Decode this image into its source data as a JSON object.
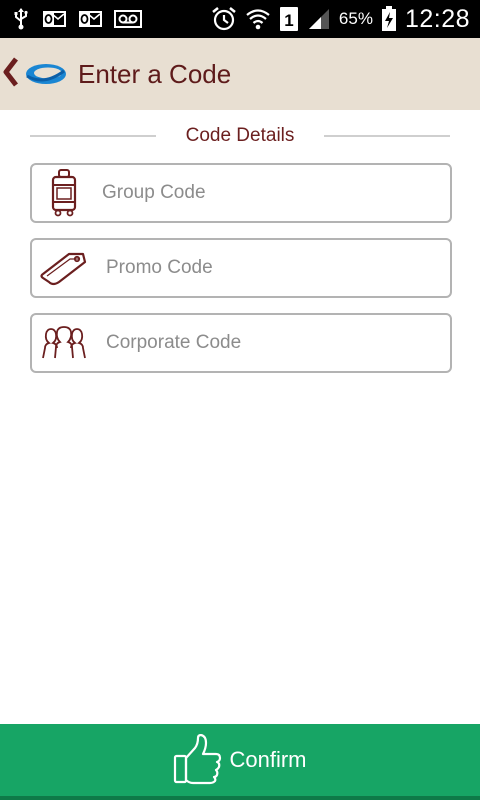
{
  "status_bar": {
    "battery_percent": "65%",
    "time": "12:28",
    "sim_slot": "1",
    "icons": [
      "usb-icon",
      "outlook-icon",
      "outlook-icon",
      "voicemail-icon",
      "alarm-icon",
      "wifi-icon",
      "sim-icon",
      "signal-icon",
      "battery-charging-icon"
    ]
  },
  "header": {
    "title": "Enter a Code",
    "back_icon": "chevron-left-icon",
    "logo_icon": "brand-logo-icon"
  },
  "section": {
    "title": "Code Details"
  },
  "fields": [
    {
      "placeholder": "Group Code",
      "value": "",
      "icon": "luggage-icon"
    },
    {
      "placeholder": "Promo Code",
      "value": "",
      "icon": "tag-icon"
    },
    {
      "placeholder": "Corporate Code",
      "value": "",
      "icon": "people-icon"
    }
  ],
  "confirm": {
    "label": "Confirm",
    "icon": "thumbs-up-icon"
  },
  "colors": {
    "header_bg": "#e8dfd2",
    "accent_text": "#5e1b1b",
    "confirm_bg": "#17a565",
    "field_border": "#b3b3b3"
  }
}
